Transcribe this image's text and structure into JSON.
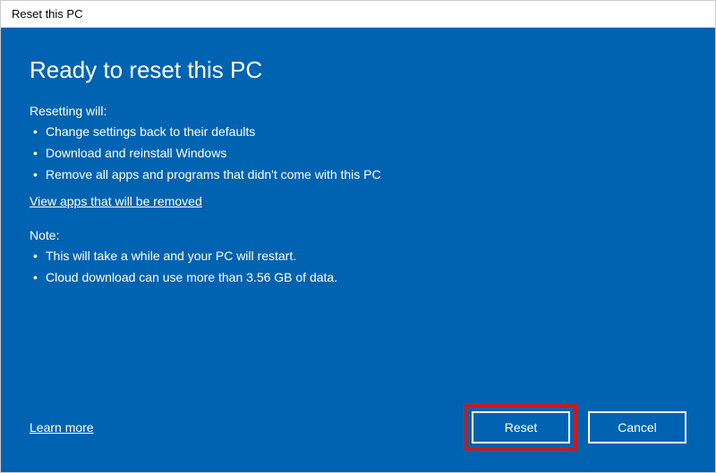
{
  "titlebar": "Reset this PC",
  "heading": "Ready to reset this PC",
  "resetting_label": "Resetting will:",
  "resetting_bullets": [
    "Change settings back to their defaults",
    "Download and reinstall Windows",
    "Remove all apps and programs that didn't come with this PC"
  ],
  "view_apps_link": "View apps that will be removed",
  "note_label": "Note:",
  "note_bullets": [
    "This will take a while and your PC will restart.",
    "Cloud download can use more than 3.56 GB of data."
  ],
  "learn_more": "Learn more",
  "buttons": {
    "reset": "Reset",
    "cancel": "Cancel"
  }
}
